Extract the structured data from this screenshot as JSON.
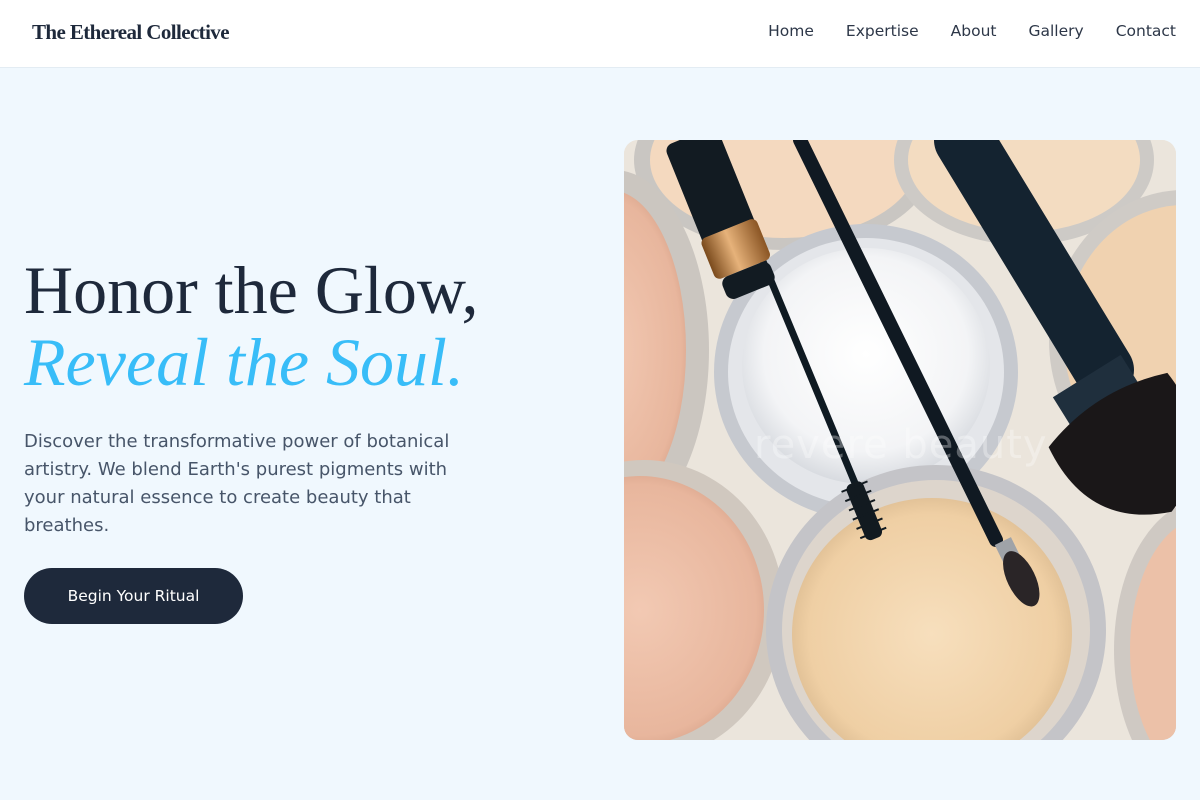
{
  "header": {
    "brand": "The Ethereal Collective",
    "nav": [
      "Home",
      "Expertise",
      "About",
      "Gallery",
      "Contact"
    ]
  },
  "hero": {
    "headline_line1": "Honor the Glow,",
    "headline_line2": "Reveal the Soul.",
    "description": "Discover the transformative power of botanical artistry. We blend Earth's purest pigments with your natural essence to create beauty that breathes.",
    "cta_label": "Begin Your Ritual",
    "image_watermark": "revere beauty"
  },
  "colors": {
    "accent": "#38bdf8",
    "primary_dark": "#1e293b",
    "background": "#f0f8fe"
  }
}
